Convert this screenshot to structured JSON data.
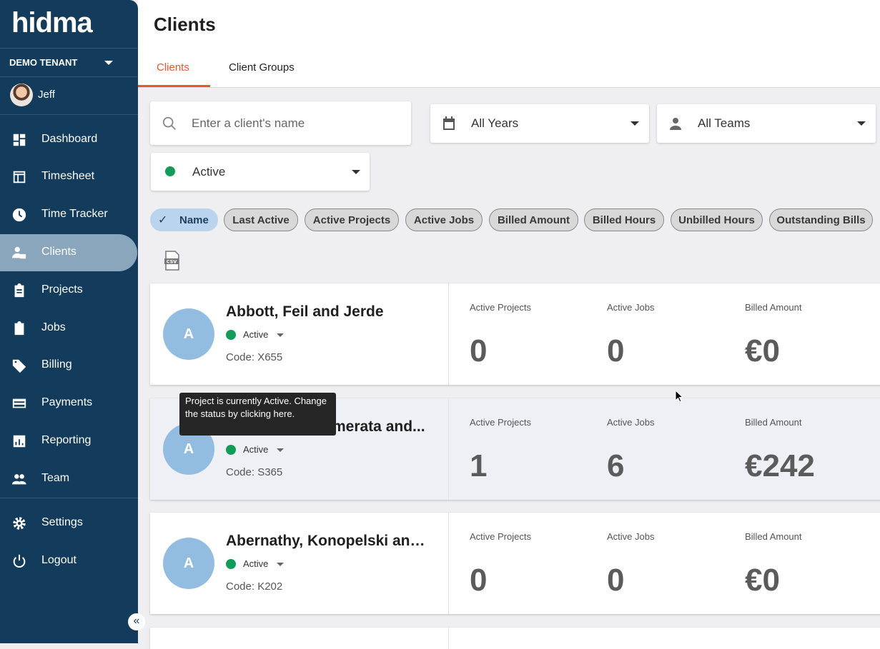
{
  "app": {
    "logo": "hidma",
    "tenant": "DEMO TENANT",
    "user": "Jeff"
  },
  "nav": [
    {
      "label": "Dashboard",
      "icon": "dashboard-icon"
    },
    {
      "label": "Timesheet",
      "icon": "timesheet-icon"
    },
    {
      "label": "Time Tracker",
      "icon": "clock-icon"
    },
    {
      "label": "Clients",
      "icon": "clients-icon",
      "active": true
    },
    {
      "label": "Projects",
      "icon": "clipboard-icon"
    },
    {
      "label": "Jobs",
      "icon": "jobs-icon"
    },
    {
      "label": "Billing",
      "icon": "tag-icon"
    },
    {
      "label": "Payments",
      "icon": "credit-card-icon"
    },
    {
      "label": "Reporting",
      "icon": "chart-icon"
    },
    {
      "label": "Team",
      "icon": "people-icon"
    },
    {
      "label": "Settings",
      "icon": "gear-icon"
    },
    {
      "label": "Logout",
      "icon": "power-icon"
    }
  ],
  "page": {
    "title": "Clients"
  },
  "tabs": {
    "clients": "Clients",
    "groups": "Client Groups"
  },
  "filters": {
    "search_placeholder": "Enter a client's name",
    "years": "All Years",
    "teams": "All Teams",
    "status": "Active"
  },
  "sort_chips": [
    "Name",
    "Last Active",
    "Active Projects",
    "Active Jobs",
    "Billed Amount",
    "Billed Hours",
    "Unbilled Hours",
    "Outstanding Bills"
  ],
  "metric_labels": {
    "projects": "Active Projects",
    "jobs": "Active Jobs",
    "billed": "Billed Amount"
  },
  "clients": [
    {
      "initial": "A",
      "name": "Abbott, Feil and Jerde",
      "status": "Active",
      "code": "Code: X655",
      "projects": "0",
      "jobs": "0",
      "billed": "€0"
    },
    {
      "initial": "A",
      "name": "Abernathy, Cremerata and...",
      "status": "Active",
      "code": "Code: S365",
      "projects": "1",
      "jobs": "6",
      "billed": "€242"
    },
    {
      "initial": "A",
      "name": "Abernathy, Konopelski and ...",
      "status": "Active",
      "code": "Code: K202",
      "projects": "0",
      "jobs": "0",
      "billed": "€0"
    }
  ],
  "tooltip": "Project is currently Active. Change the status by clicking here.",
  "colors": {
    "sidebar": "#123b5c",
    "accent": "#e8572a",
    "active_dot": "#0f9d58",
    "avatar": "#92bde0"
  }
}
